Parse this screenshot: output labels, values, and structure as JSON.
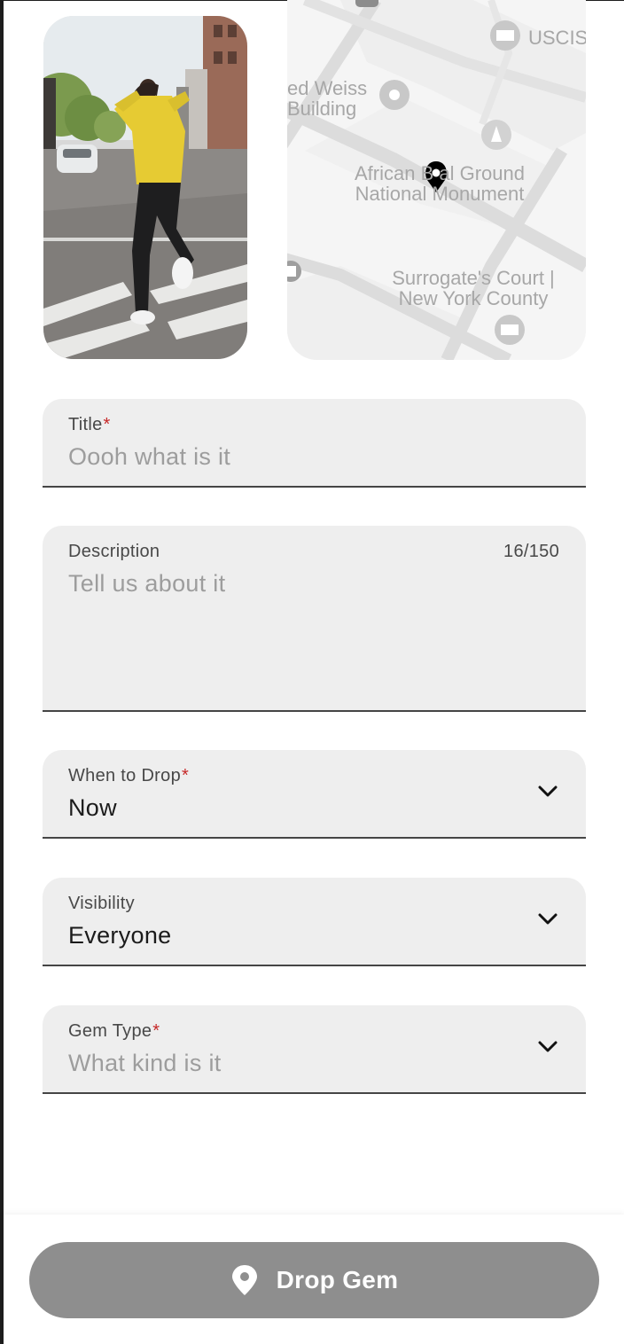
{
  "map": {
    "labels": {
      "weiss": "ed Weiss\nBuilding",
      "uscis": "USCIS",
      "african": "African B   al Ground\nNational Monument",
      "surrogate": "Surrogate's Court |\nNew York County"
    }
  },
  "form": {
    "title": {
      "label": "Title",
      "required_mark": "*",
      "placeholder": "Oooh what is it"
    },
    "description": {
      "label": "Description",
      "placeholder": "Tell us about it",
      "counter": "16/150"
    },
    "when_to_drop": {
      "label": "When to Drop",
      "required_mark": "*",
      "value": "Now"
    },
    "visibility": {
      "label": "Visibility",
      "value": "Everyone"
    },
    "gem_type": {
      "label": "Gem Type",
      "required_mark": "*",
      "placeholder": "What kind is it"
    }
  },
  "actions": {
    "drop_label": "Drop Gem"
  },
  "icons": {
    "chevron": "chevron-down-icon",
    "pin": "location-pin-icon"
  },
  "colors": {
    "field_bg": "#eeeeee",
    "required": "#c62828",
    "button_bg": "#8e8e8e"
  }
}
